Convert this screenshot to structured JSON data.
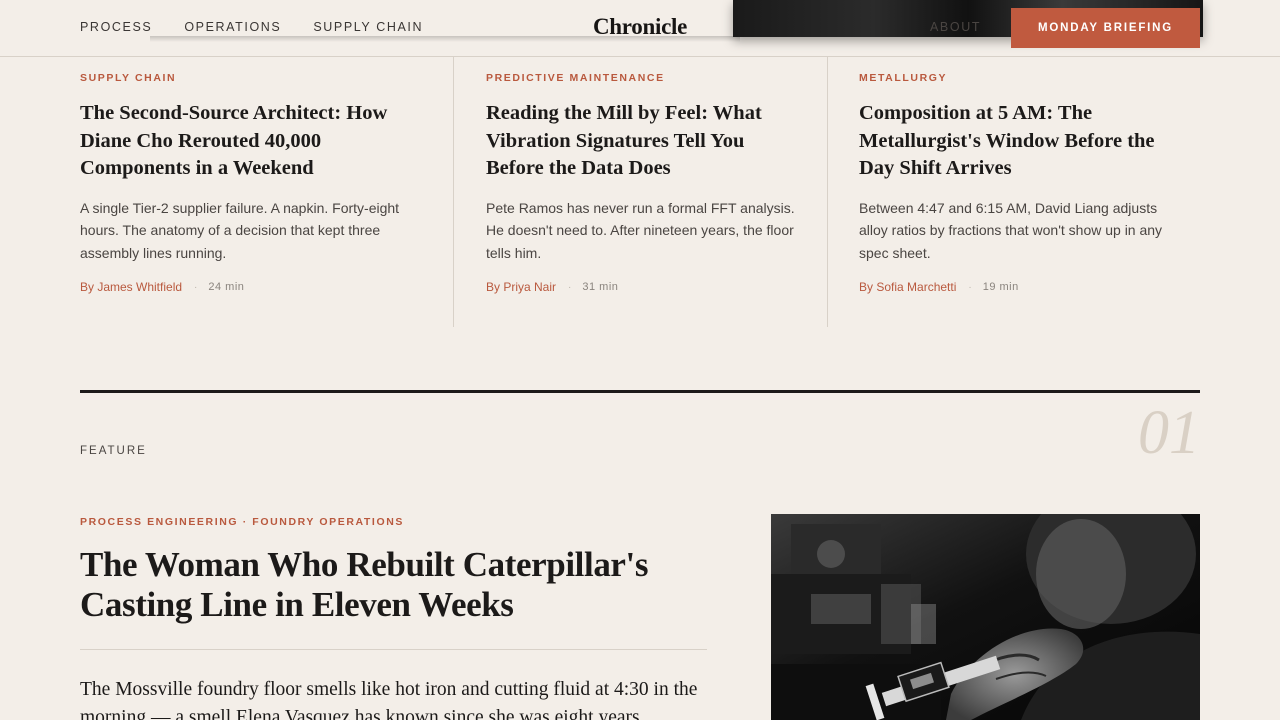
{
  "nav": {
    "left_links": [
      "PROCESS",
      "OPERATIONS",
      "SUPPLY CHAIN"
    ],
    "brand": "Chronicle",
    "about": "ABOUT",
    "cta": "MONDAY BRIEFING"
  },
  "stories": [
    {
      "kicker": "SUPPLY CHAIN",
      "title": "The Second-Source Architect: How Diane Cho Rerouted 40,000 Components in a Weekend",
      "dek": "A single Tier-2 supplier failure. A napkin. Forty-eight hours. The anatomy of a decision that kept three assembly lines running.",
      "author": "By James Whitfield",
      "separator": "·",
      "read_time": "24 min"
    },
    {
      "kicker": "PREDICTIVE MAINTENANCE",
      "title": "Reading the Mill by Feel: What Vibration Signatures Tell You Before the Data Does",
      "dek": "Pete Ramos has never run a formal FFT analysis. He doesn't need to. After nineteen years, the floor tells him.",
      "author": "By Priya Nair",
      "separator": "·",
      "read_time": "31 min"
    },
    {
      "kicker": "METALLURGY",
      "title": "Composition at 5 AM: The Metallurgist's Window Before the Day Shift Arrives",
      "dek": "Between 4:47 and 6:15 AM, David Liang adjusts alloy ratios by fractions that won't show up in any spec sheet.",
      "author": "By Sofia Marchetti",
      "separator": "·",
      "read_time": "19 min"
    }
  ],
  "feature": {
    "section_label": "FEATURE",
    "section_number": "01",
    "kicker": "PROCESS ENGINEERING · FOUNDRY OPERATIONS",
    "title": "The Woman Who Rebuilt Caterpillar's Casting Line in Eleven Weeks",
    "body": "The Mossville foundry floor smells like hot iron and cutting fluid at 4:30 in the morning — a smell Elena Vasquez has known since she was eight years"
  },
  "colors": {
    "background": "#f3eee8",
    "accent": "#c05a3f",
    "kicker": "#b9593e",
    "text": "#1c1a19",
    "rule": "#d8d1c8"
  },
  "icons": {
    "feature_photo": "black-and-white photo of hands measuring a part with digital calipers"
  }
}
